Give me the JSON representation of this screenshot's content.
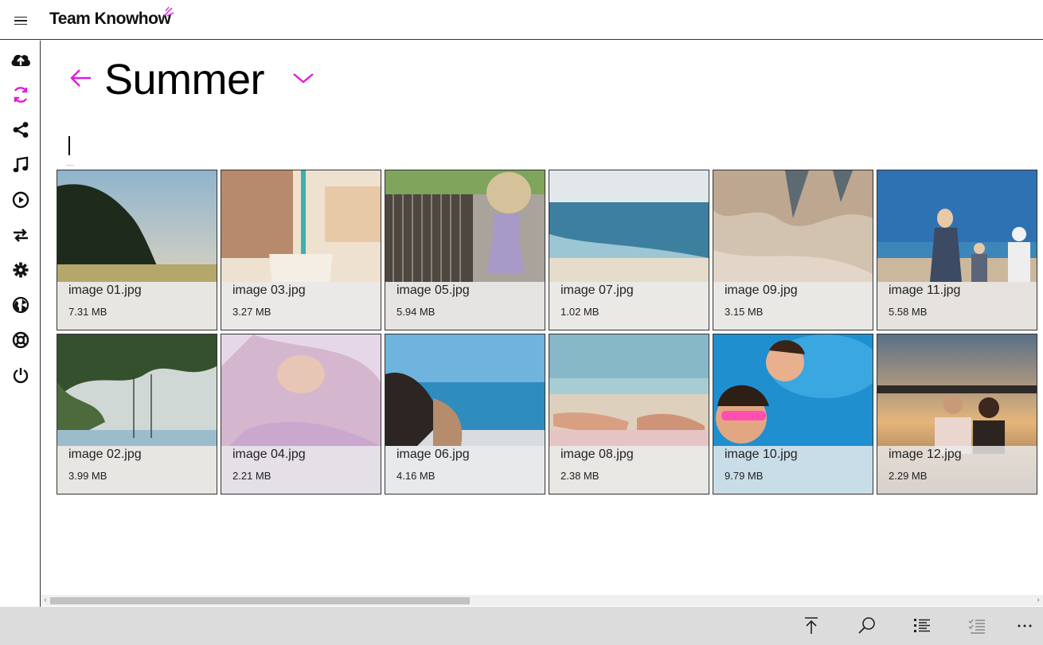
{
  "app": {
    "title": "Team Knowhow",
    "accent": "#e01ae0"
  },
  "folder": {
    "title": "Summer"
  },
  "sidebar": {
    "items": [
      {
        "icon": "cloud-upload-icon",
        "active": false
      },
      {
        "icon": "sync-icon",
        "active": true
      },
      {
        "icon": "share-icon",
        "active": false
      },
      {
        "icon": "music-icon",
        "active": false
      },
      {
        "icon": "play-icon",
        "active": false
      },
      {
        "icon": "transfer-icon",
        "active": false
      },
      {
        "icon": "gear-icon",
        "active": false
      },
      {
        "icon": "globe-icon",
        "active": false
      },
      {
        "icon": "help-lifebuoy-icon",
        "active": false
      },
      {
        "icon": "power-icon",
        "active": false
      }
    ]
  },
  "files": [
    {
      "name": "image 01.jpg",
      "size": "7.31 MB"
    },
    {
      "name": "image 02.jpg",
      "size": "3.99 MB"
    },
    {
      "name": "image 03.jpg",
      "size": "3.27 MB"
    },
    {
      "name": "image 04.jpg",
      "size": "2.21 MB"
    },
    {
      "name": "image 05.jpg",
      "size": "5.94 MB"
    },
    {
      "name": "image 06.jpg",
      "size": "4.16 MB"
    },
    {
      "name": "image 07.jpg",
      "size": "1.02 MB"
    },
    {
      "name": "image 08.jpg",
      "size": "2.38 MB"
    },
    {
      "name": "image 09.jpg",
      "size": "3.15 MB"
    },
    {
      "name": "image 10.jpg",
      "size": "9.79 MB"
    },
    {
      "name": "image 11.jpg",
      "size": "5.58 MB"
    },
    {
      "name": "image 12.jpg",
      "size": "2.29 MB"
    }
  ],
  "appbar": {
    "buttons": [
      {
        "icon": "upload-to-top-icon"
      },
      {
        "icon": "search-icon"
      },
      {
        "icon": "list-view-icon"
      },
      {
        "icon": "select-checklist-icon"
      },
      {
        "icon": "more-icon"
      }
    ]
  }
}
